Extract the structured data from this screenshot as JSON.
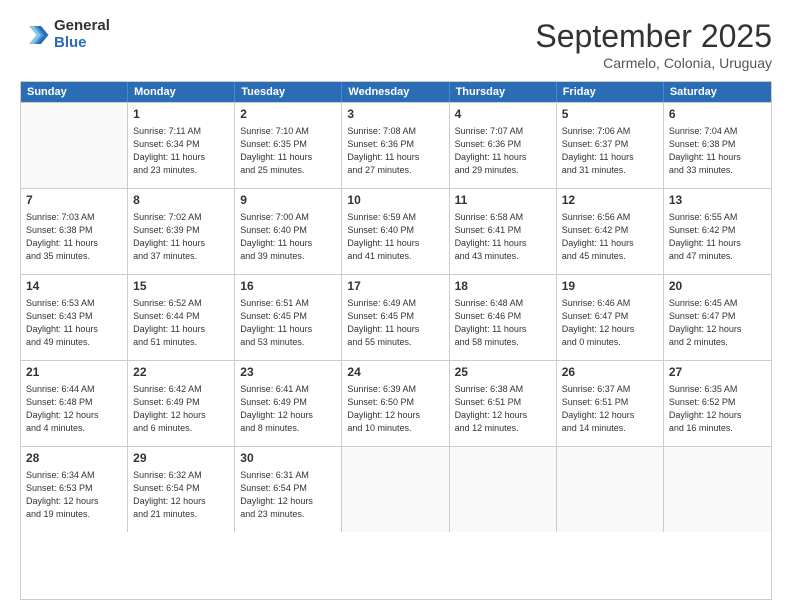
{
  "logo": {
    "general": "General",
    "blue": "Blue"
  },
  "title": "September 2025",
  "location": "Carmelo, Colonia, Uruguay",
  "days": [
    "Sunday",
    "Monday",
    "Tuesday",
    "Wednesday",
    "Thursday",
    "Friday",
    "Saturday"
  ],
  "weeks": [
    [
      {
        "day": "",
        "info": ""
      },
      {
        "day": "1",
        "info": "Sunrise: 7:11 AM\nSunset: 6:34 PM\nDaylight: 11 hours\nand 23 minutes."
      },
      {
        "day": "2",
        "info": "Sunrise: 7:10 AM\nSunset: 6:35 PM\nDaylight: 11 hours\nand 25 minutes."
      },
      {
        "day": "3",
        "info": "Sunrise: 7:08 AM\nSunset: 6:36 PM\nDaylight: 11 hours\nand 27 minutes."
      },
      {
        "day": "4",
        "info": "Sunrise: 7:07 AM\nSunset: 6:36 PM\nDaylight: 11 hours\nand 29 minutes."
      },
      {
        "day": "5",
        "info": "Sunrise: 7:06 AM\nSunset: 6:37 PM\nDaylight: 11 hours\nand 31 minutes."
      },
      {
        "day": "6",
        "info": "Sunrise: 7:04 AM\nSunset: 6:38 PM\nDaylight: 11 hours\nand 33 minutes."
      }
    ],
    [
      {
        "day": "7",
        "info": "Sunrise: 7:03 AM\nSunset: 6:38 PM\nDaylight: 11 hours\nand 35 minutes."
      },
      {
        "day": "8",
        "info": "Sunrise: 7:02 AM\nSunset: 6:39 PM\nDaylight: 11 hours\nand 37 minutes."
      },
      {
        "day": "9",
        "info": "Sunrise: 7:00 AM\nSunset: 6:40 PM\nDaylight: 11 hours\nand 39 minutes."
      },
      {
        "day": "10",
        "info": "Sunrise: 6:59 AM\nSunset: 6:40 PM\nDaylight: 11 hours\nand 41 minutes."
      },
      {
        "day": "11",
        "info": "Sunrise: 6:58 AM\nSunset: 6:41 PM\nDaylight: 11 hours\nand 43 minutes."
      },
      {
        "day": "12",
        "info": "Sunrise: 6:56 AM\nSunset: 6:42 PM\nDaylight: 11 hours\nand 45 minutes."
      },
      {
        "day": "13",
        "info": "Sunrise: 6:55 AM\nSunset: 6:42 PM\nDaylight: 11 hours\nand 47 minutes."
      }
    ],
    [
      {
        "day": "14",
        "info": "Sunrise: 6:53 AM\nSunset: 6:43 PM\nDaylight: 11 hours\nand 49 minutes."
      },
      {
        "day": "15",
        "info": "Sunrise: 6:52 AM\nSunset: 6:44 PM\nDaylight: 11 hours\nand 51 minutes."
      },
      {
        "day": "16",
        "info": "Sunrise: 6:51 AM\nSunset: 6:45 PM\nDaylight: 11 hours\nand 53 minutes."
      },
      {
        "day": "17",
        "info": "Sunrise: 6:49 AM\nSunset: 6:45 PM\nDaylight: 11 hours\nand 55 minutes."
      },
      {
        "day": "18",
        "info": "Sunrise: 6:48 AM\nSunset: 6:46 PM\nDaylight: 11 hours\nand 58 minutes."
      },
      {
        "day": "19",
        "info": "Sunrise: 6:46 AM\nSunset: 6:47 PM\nDaylight: 12 hours\nand 0 minutes."
      },
      {
        "day": "20",
        "info": "Sunrise: 6:45 AM\nSunset: 6:47 PM\nDaylight: 12 hours\nand 2 minutes."
      }
    ],
    [
      {
        "day": "21",
        "info": "Sunrise: 6:44 AM\nSunset: 6:48 PM\nDaylight: 12 hours\nand 4 minutes."
      },
      {
        "day": "22",
        "info": "Sunrise: 6:42 AM\nSunset: 6:49 PM\nDaylight: 12 hours\nand 6 minutes."
      },
      {
        "day": "23",
        "info": "Sunrise: 6:41 AM\nSunset: 6:49 PM\nDaylight: 12 hours\nand 8 minutes."
      },
      {
        "day": "24",
        "info": "Sunrise: 6:39 AM\nSunset: 6:50 PM\nDaylight: 12 hours\nand 10 minutes."
      },
      {
        "day": "25",
        "info": "Sunrise: 6:38 AM\nSunset: 6:51 PM\nDaylight: 12 hours\nand 12 minutes."
      },
      {
        "day": "26",
        "info": "Sunrise: 6:37 AM\nSunset: 6:51 PM\nDaylight: 12 hours\nand 14 minutes."
      },
      {
        "day": "27",
        "info": "Sunrise: 6:35 AM\nSunset: 6:52 PM\nDaylight: 12 hours\nand 16 minutes."
      }
    ],
    [
      {
        "day": "28",
        "info": "Sunrise: 6:34 AM\nSunset: 6:53 PM\nDaylight: 12 hours\nand 19 minutes."
      },
      {
        "day": "29",
        "info": "Sunrise: 6:32 AM\nSunset: 6:54 PM\nDaylight: 12 hours\nand 21 minutes."
      },
      {
        "day": "30",
        "info": "Sunrise: 6:31 AM\nSunset: 6:54 PM\nDaylight: 12 hours\nand 23 minutes."
      },
      {
        "day": "",
        "info": ""
      },
      {
        "day": "",
        "info": ""
      },
      {
        "day": "",
        "info": ""
      },
      {
        "day": "",
        "info": ""
      }
    ]
  ]
}
